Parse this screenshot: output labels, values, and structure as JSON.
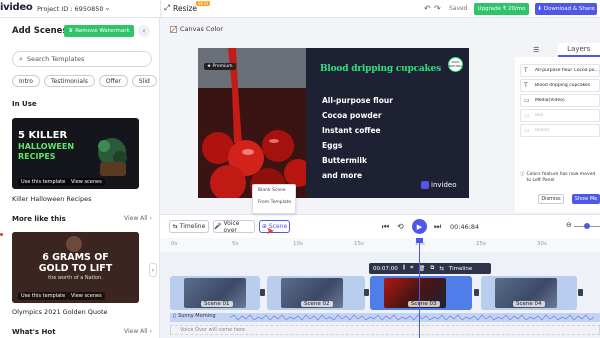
{
  "topbar": {
    "logo": "ivideo",
    "project_id": "Project ID : 6950850",
    "resize": "Resize",
    "beta": "BETA",
    "saved": "Saved",
    "upgrade": "Upgrade ₹ 20/mo",
    "download": "Download & Share"
  },
  "left_panel": {
    "title": "Add Scenes",
    "remove_watermark": "Remove Watermark",
    "search_placeholder": "Search Templates",
    "chips": [
      "Intro",
      "Testimonials",
      "Offer",
      "Slid"
    ],
    "in_use": {
      "heading": "In Use",
      "thumb_lines": [
        "5 KILLER",
        "HALLOWEEN",
        "RECIPES"
      ],
      "use_btn": "Use this template",
      "view_btn": "View scenes",
      "label": "Killer Halloween Recipes"
    },
    "more_like_this": {
      "heading": "More like this",
      "view_all": "View All",
      "thumb_lines": [
        "6 GRAMS OF",
        "GOLD TO LIFT",
        "the worth of a Nation."
      ],
      "use_btn": "Use this template",
      "view_btn": "View scenes",
      "label": "Olympics 2021 Golden Quote"
    },
    "whats_hot": {
      "heading": "What's Hot",
      "view_all": "View All"
    }
  },
  "canvas": {
    "canvas_color": "Canvas Color",
    "premium": "Premium",
    "title": "Blood dripping cupcakes",
    "badge": "100% NATURAL",
    "ingredients": [
      "All-purpose flour",
      "Cocoa powder",
      "Instant coffee",
      "Eggs",
      "Buttermilk",
      "and more"
    ],
    "brand": "invideo"
  },
  "right_panel": {
    "tab_layers": "Layers",
    "layers": [
      {
        "icon": "T",
        "label": "All-purpose flour Cocoa po..."
      },
      {
        "icon": "T",
        "label": "Blood dripping cupcakes"
      },
      {
        "icon": "▭",
        "label": "Media(Video)"
      },
      {
        "icon": "▭",
        "label": "Box"
      },
      {
        "icon": "▭",
        "label": "Blocks"
      }
    ],
    "note": "Colors feature has now moved to Left Panel",
    "dismiss": "Dismiss",
    "show_me": "Show Me"
  },
  "timeline": {
    "timeline_btn": "Timeline",
    "voice_over_btn": "Voice over",
    "scene_btn": "Scene",
    "popover": [
      "Blank Scene",
      "From Template"
    ],
    "time": "00:46:84",
    "ticks": [
      "0s",
      "5s",
      "10s",
      "15s",
      "20s",
      "25s",
      "30s"
    ],
    "clip_toolbar_time": "00:07:00",
    "clip_toolbar_timeline": "Timeline",
    "scenes": [
      "Scene 01",
      "Scene 02",
      "Scene 03",
      "Scene 04"
    ],
    "audio": "Sunny Morning",
    "voice_placeholder": "Voice Over will come here"
  },
  "colors": {
    "accent": "#4f57e8",
    "green": "#30c46a",
    "video_title": "#2ee27a",
    "video_bg": "#1e2133"
  }
}
